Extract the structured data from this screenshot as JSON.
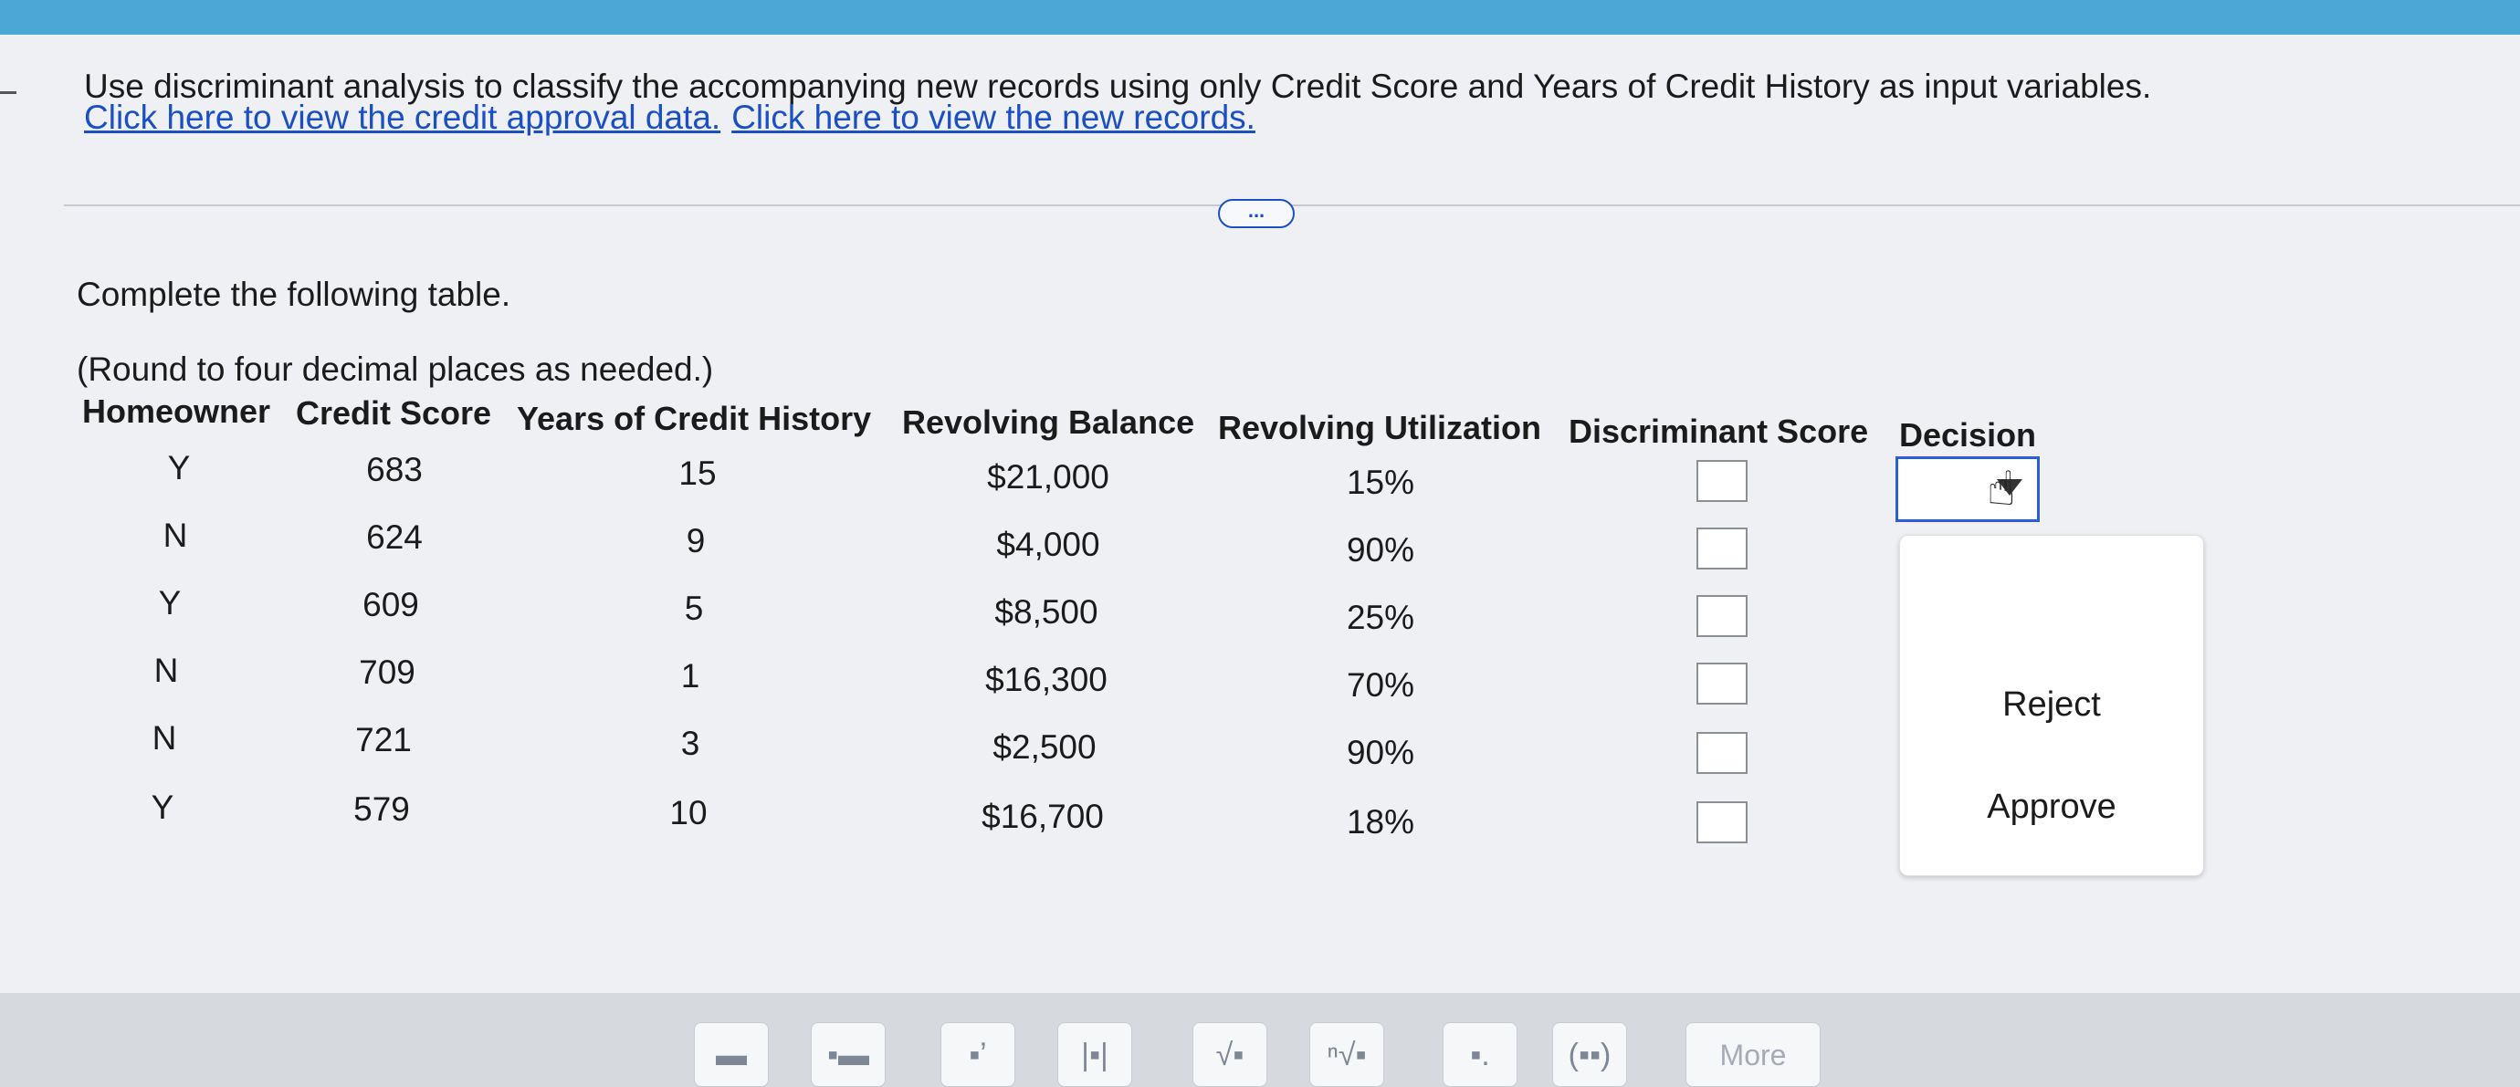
{
  "problem": {
    "intro": "Use discriminant analysis to classify the accompanying new records using only Credit Score and Years of Credit History as input variables.",
    "link_credit": "Click here to view the credit approval data.",
    "link_new": "Click here to view the new records.",
    "more_pill": "..."
  },
  "task": {
    "instruction": "Complete the following table.",
    "rounding": "(Round to four decimal places as needed.)"
  },
  "table": {
    "headers": [
      "Homeowner",
      "Credit Score",
      "Years of Credit History",
      "Revolving Balance",
      "Revolving Utilization",
      "Discriminant Score",
      "Decision"
    ],
    "rows": [
      {
        "homeowner": "Y",
        "credit_score": "683",
        "years": "15",
        "balance": "$21,000",
        "utilization": "15%"
      },
      {
        "homeowner": "N",
        "credit_score": "624",
        "years": "9",
        "balance": "$4,000",
        "utilization": "90%"
      },
      {
        "homeowner": "Y",
        "credit_score": "609",
        "years": "5",
        "balance": "$8,500",
        "utilization": "25%"
      },
      {
        "homeowner": "N",
        "credit_score": "709",
        "years": "1",
        "balance": "$16,300",
        "utilization": "70%"
      },
      {
        "homeowner": "N",
        "credit_score": "721",
        "years": "3",
        "balance": "$2,500",
        "utilization": "90%"
      },
      {
        "homeowner": "Y",
        "credit_score": "579",
        "years": "10",
        "balance": "$16,700",
        "utilization": "18%"
      }
    ]
  },
  "decision_dropdown": {
    "selected": "",
    "options": [
      "Reject",
      "Approve"
    ]
  },
  "toolbar": {
    "buttons": [
      "fraction-icon",
      "mixed-number-icon",
      "exponent-icon",
      "absolute-value-icon",
      "square-root-icon",
      "nth-root-icon",
      "subscript-icon",
      "parentheses-icon"
    ],
    "more_label": "More"
  }
}
